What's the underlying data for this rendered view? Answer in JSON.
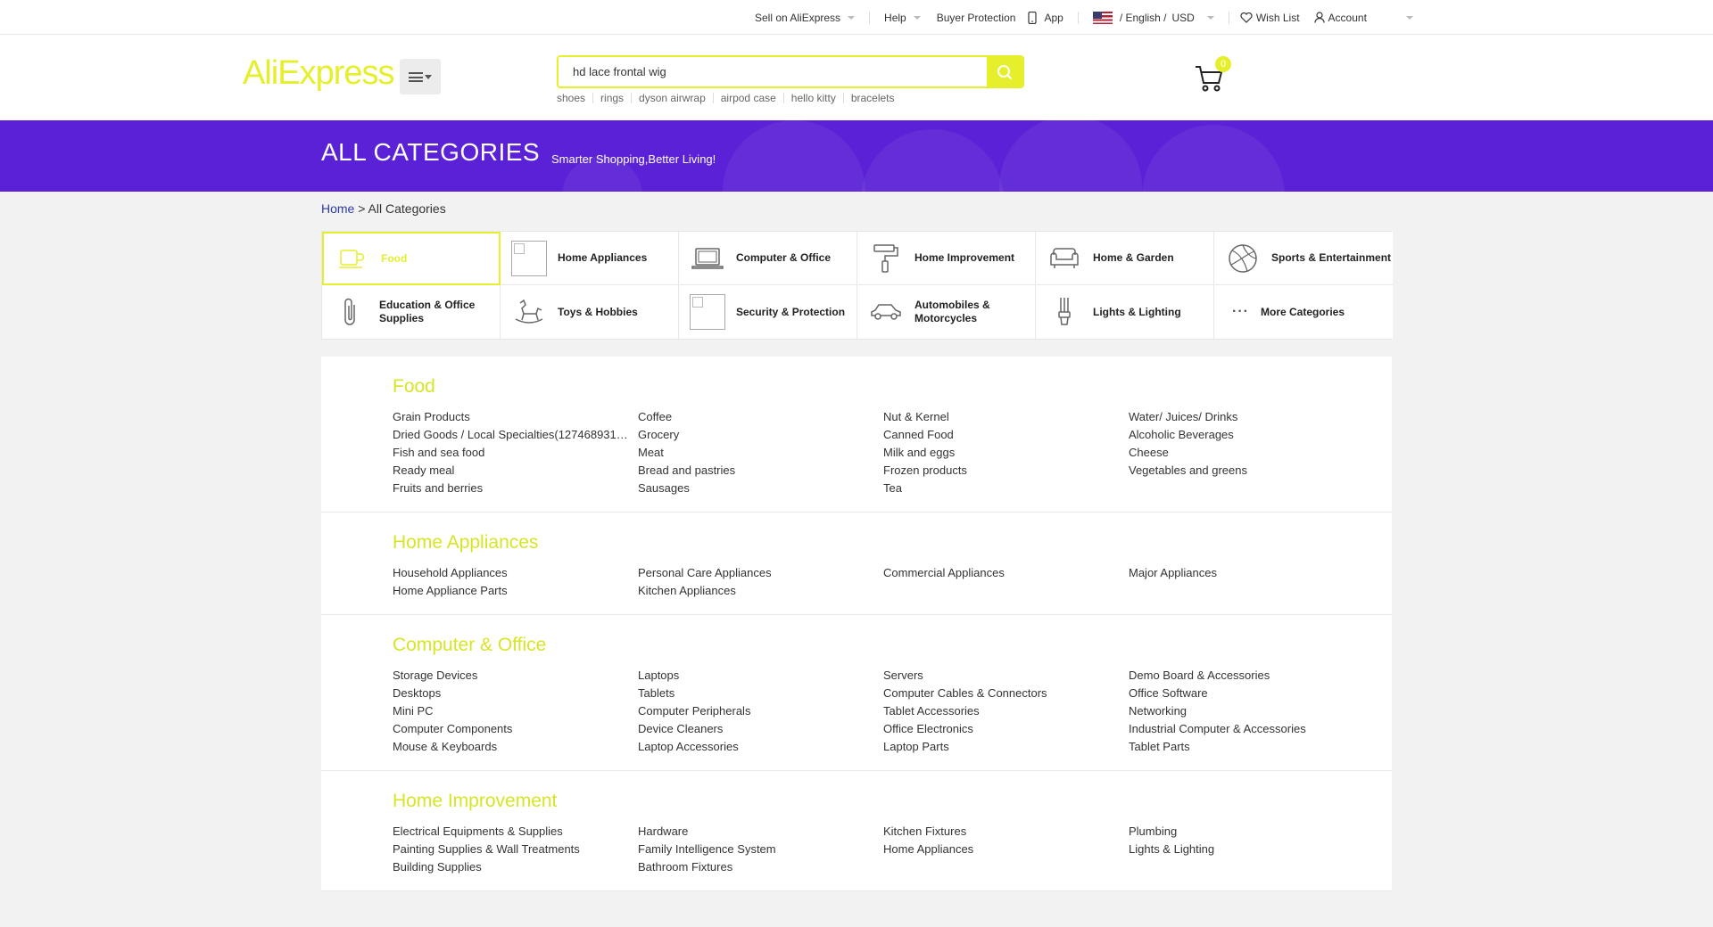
{
  "topbar": {
    "sell": "Sell on AliExpress",
    "help": "Help",
    "buyer_protection": "Buyer Protection",
    "app": "App",
    "language": "/ English /",
    "currency": "USD",
    "wishlist": "Wish List",
    "account": "Account"
  },
  "header": {
    "logo": "AliExpress",
    "search_value": "hd lace frontal wig",
    "hot_searches": [
      "shoes",
      "rings",
      "dyson airwrap",
      "airpod case",
      "hello kitty",
      "bracelets"
    ],
    "cart_count": "0"
  },
  "colors": {
    "accent": "#e5ef2c",
    "banner": "#5a21d6",
    "breadcrumb_link": "#2b3aa8"
  },
  "banner": {
    "title": "ALL CATEGORIES",
    "subtitle": "Smarter Shopping,Better Living!"
  },
  "breadcrumb": {
    "home": "Home",
    "current": "> All Categories"
  },
  "categories": [
    {
      "label": "Food",
      "icon": "cup-icon",
      "active": true
    },
    {
      "label": "Home Appliances",
      "icon": "broken-image-icon"
    },
    {
      "label": "Computer & Office",
      "icon": "laptop-icon"
    },
    {
      "label": "Home Improvement",
      "icon": "paint-roller-icon"
    },
    {
      "label": "Home & Garden",
      "icon": "sofa-icon"
    },
    {
      "label": "Sports & Entertainment",
      "icon": "ball-icon"
    },
    {
      "label": "Education & Office Supplies",
      "icon": "paperclip-icon"
    },
    {
      "label": "Toys & Hobbies",
      "icon": "rocking-horse-icon"
    },
    {
      "label": "Security & Protection",
      "icon": "broken-image-icon"
    },
    {
      "label": "Automobiles & Motorcycles",
      "icon": "car-icon"
    },
    {
      "label": "Lights & Lighting",
      "icon": "bulb-icon"
    },
    {
      "label": "More Categories",
      "icon": "more-icon"
    }
  ],
  "sections": [
    {
      "title": "Food",
      "items": [
        "Grain Products",
        "Coffee",
        "Nut & Kernel",
        "Water/ Juices/ Drinks",
        "Dried Goods / Local Specialties(127468931…",
        "Grocery",
        "Canned Food",
        "Alcoholic Beverages",
        "Fish and sea food",
        "Meat",
        "Milk and eggs",
        "Cheese",
        "Ready meal",
        "Bread and pastries",
        "Frozen products",
        "Vegetables and greens",
        "Fruits and berries",
        "Sausages",
        "Tea",
        ""
      ]
    },
    {
      "title": "Home Appliances",
      "items": [
        "Household Appliances",
        "Personal Care Appliances",
        "Commercial Appliances",
        "Major Appliances",
        "Home Appliance Parts",
        "Kitchen Appliances",
        "",
        ""
      ]
    },
    {
      "title": "Computer & Office",
      "items": [
        "Storage Devices",
        "Laptops",
        "Servers",
        "Demo Board & Accessories",
        "Desktops",
        "Tablets",
        "Computer Cables & Connectors",
        "Office Software",
        "Mini PC",
        "Computer Peripherals",
        "Tablet Accessories",
        "Networking",
        "Computer Components",
        "Device Cleaners",
        "Office Electronics",
        "Industrial Computer & Accessories",
        "Mouse & Keyboards",
        "Laptop Accessories",
        "Laptop Parts",
        "Tablet Parts"
      ]
    },
    {
      "title": "Home Improvement",
      "items": [
        "Electrical Equipments & Supplies",
        "Hardware",
        "Kitchen Fixtures",
        "Plumbing",
        "Painting Supplies & Wall Treatments",
        "Family Intelligence System",
        "Home Appliances",
        "Lights & Lighting",
        "Building Supplies",
        "Bathroom Fixtures",
        "",
        ""
      ]
    }
  ]
}
